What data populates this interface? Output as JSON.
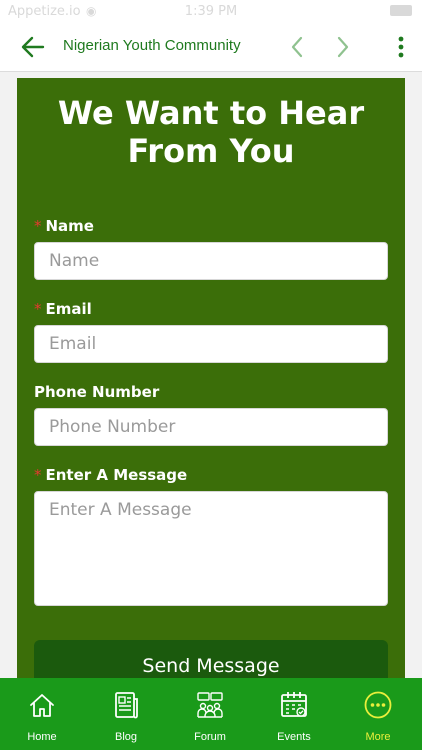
{
  "status_bar": {
    "carrier": "Appetize.io",
    "time": "1:39 PM"
  },
  "nav": {
    "title": "Nigerian Youth Community",
    "accent_color": "#1f7a1f",
    "icons": [
      "arrow-left-icon",
      "chevron-left-icon",
      "chevron-right-icon",
      "more-vertical-icon"
    ]
  },
  "form": {
    "heading": "We Want to Hear From You",
    "background_color": "#3b6e09",
    "fields": [
      {
        "label": "Name",
        "required": true,
        "placeholder": "Name",
        "value": ""
      },
      {
        "label": "Email",
        "required": true,
        "placeholder": "Email",
        "value": ""
      },
      {
        "label": "Phone Number",
        "required": false,
        "placeholder": "Phone Number",
        "value": ""
      },
      {
        "label": "Enter A Message",
        "required": true,
        "placeholder": "Enter A Message",
        "value": ""
      }
    ],
    "required_marker": "*",
    "submit_label": "Send Message"
  },
  "tab_bar": {
    "background_color": "#1a9a1a",
    "active_color": "#e9ee3c",
    "tabs": [
      {
        "label": "Home",
        "icon": "home-icon",
        "active": false
      },
      {
        "label": "Blog",
        "icon": "blog-icon",
        "active": false
      },
      {
        "label": "Forum",
        "icon": "forum-icon",
        "active": false
      },
      {
        "label": "Events",
        "icon": "calendar-icon",
        "active": false
      },
      {
        "label": "More",
        "icon": "more-horizontal-icon",
        "active": true
      }
    ]
  }
}
